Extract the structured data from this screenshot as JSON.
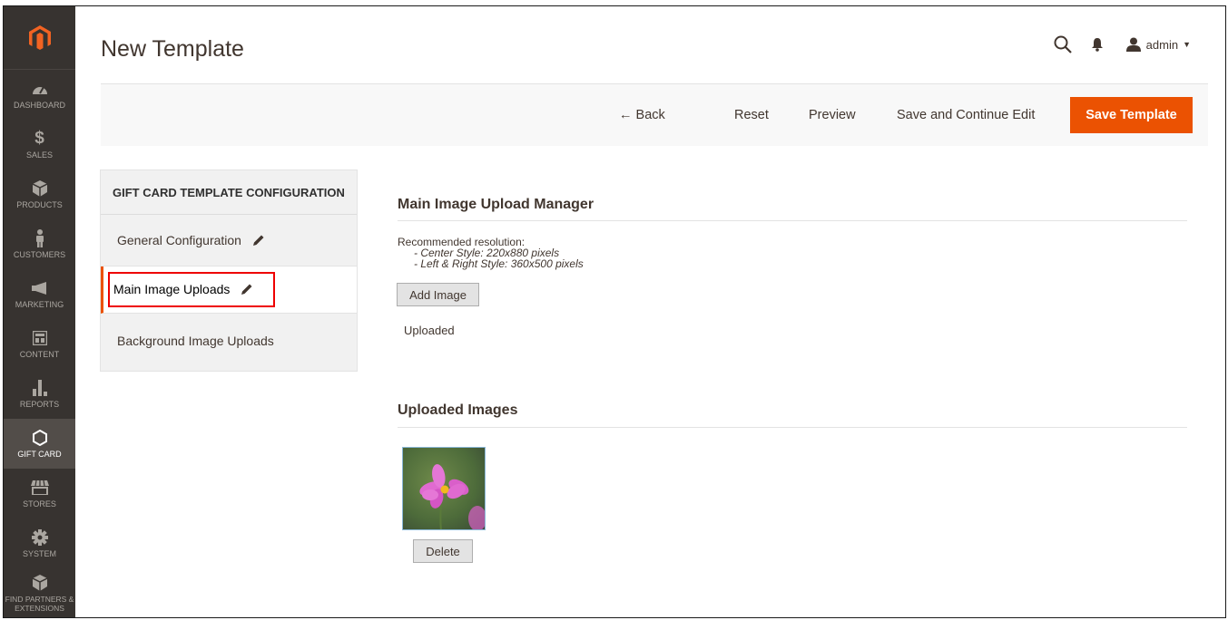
{
  "sidebar": {
    "logo_icon": "magento-logo-icon",
    "items": [
      {
        "label": "DASHBOARD",
        "icon": "dashboard-icon"
      },
      {
        "label": "SALES",
        "icon": "dollar-icon"
      },
      {
        "label": "PRODUCTS",
        "icon": "cube-icon"
      },
      {
        "label": "CUSTOMERS",
        "icon": "person-icon"
      },
      {
        "label": "MARKETING",
        "icon": "megaphone-icon"
      },
      {
        "label": "CONTENT",
        "icon": "layout-icon"
      },
      {
        "label": "REPORTS",
        "icon": "bar-chart-icon"
      },
      {
        "label": "GIFT CARD",
        "icon": "hexagon-icon"
      },
      {
        "label": "STORES",
        "icon": "store-icon"
      },
      {
        "label": "SYSTEM",
        "icon": "gear-icon"
      },
      {
        "label": "FIND PARTNERS & EXTENSIONS",
        "icon": "box-icon"
      }
    ],
    "active_index": 7
  },
  "header": {
    "title": "New Template",
    "user_label": "admin"
  },
  "toolbar": {
    "back_label": "← Back",
    "reset_label": "Reset",
    "preview_label": "Preview",
    "save_continue_label": "Save and Continue Edit",
    "save_label": "Save Template"
  },
  "config": {
    "title": "GIFT CARD TEMPLATE CONFIGURATION",
    "items": [
      {
        "label": "General Configuration"
      },
      {
        "label": "Main Image Uploads"
      },
      {
        "label": "Background Image Uploads"
      }
    ]
  },
  "main": {
    "upload_manager_title": "Main Image Upload Manager",
    "recommended_label": "Recommended resolution:",
    "center_style": "- Center Style: 220x880 pixels",
    "lr_style": "- Left & Right Style: 360x500 pixels",
    "add_image_label": "Add Image",
    "uploaded_label": "Uploaded",
    "uploaded_images_title": "Uploaded Images",
    "delete_label": "Delete"
  },
  "colors": {
    "accent": "#eb5202",
    "sidebar_bg": "#373330",
    "highlight_box": "#e00000"
  }
}
